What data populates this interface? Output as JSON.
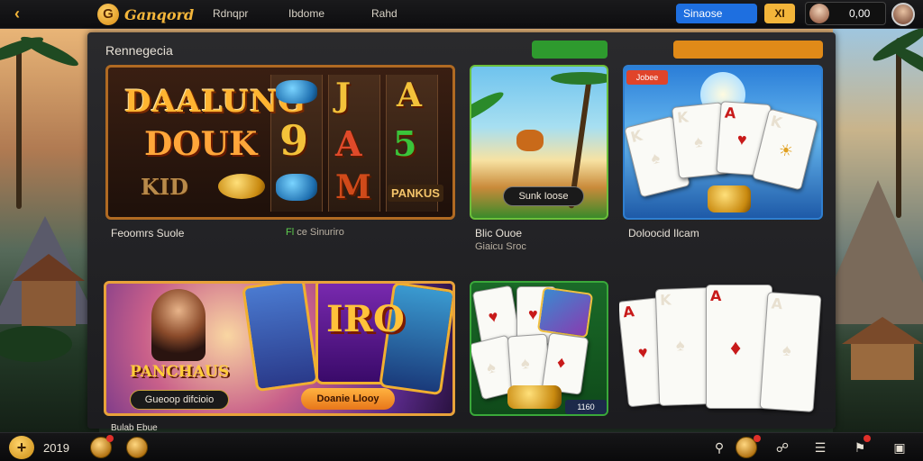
{
  "topbar": {
    "back_label": "‹",
    "brand_logo_letter": "G",
    "brand_name": "Ganqord",
    "nav": [
      "Rdnqpr",
      "Ibdome",
      "Rahd"
    ],
    "search_label": "Sinaose",
    "lang_label": "XI",
    "balance_value": "0,00"
  },
  "panel": {
    "title": "Rennegecia",
    "green_pill": "",
    "orange_pill": ""
  },
  "games": {
    "slot": {
      "title": "DAALUNG",
      "subtitle": "DOUK",
      "kid": "KID",
      "pankus": "PANKUS",
      "symbols": [
        "J",
        "A",
        "9",
        "A",
        "5",
        "M"
      ],
      "caption": "Feoomrs Suole",
      "sub_prefix": "Fl",
      "sub": "ce Sinuriro"
    },
    "beach": {
      "button": "Sunk Ioose",
      "caption": "Blic Ouoe",
      "sub": "Giaicu Sroc"
    },
    "cards": {
      "badge": "Jobee",
      "caption": "Doloocid Ilcam",
      "ranks": [
        "K",
        "K",
        "A",
        "K"
      ]
    },
    "princess": {
      "title": "PANCHAUS",
      "button": "Gueoop difcioio",
      "big_text": "IRO",
      "button2": "Doanie Llooy",
      "caption": "Bulab Ebue"
    },
    "poker": {
      "price": "1160"
    },
    "cards2": {
      "ranks": [
        "A",
        "K",
        "A",
        "A"
      ]
    }
  },
  "bottombar": {
    "add_label": "+",
    "year": "2019"
  },
  "colors": {
    "accent": "#f3b53a",
    "search_blue": "#1e6fe0",
    "pill_green": "#2e9a2e",
    "pill_orange": "#e08a18",
    "panel_bg": "#1f1f22"
  }
}
